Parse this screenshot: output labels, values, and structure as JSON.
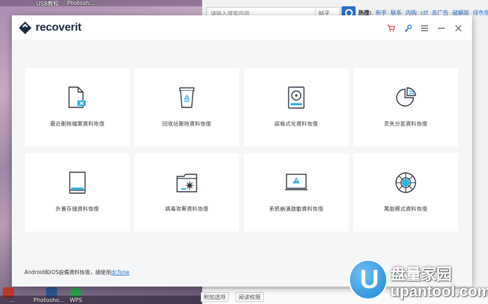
{
  "desktop": {
    "top_labels": [
      "USB教程",
      "Photosh..."
    ],
    "bottom_labels": [
      "...",
      "Photosho...",
      "WPS"
    ]
  },
  "browser": {
    "search_placeholder": "请输入搜索内容",
    "category": "帖子",
    "hot_label": "热搜:",
    "hot_items": [
      "新手",
      "联系",
      "内购",
      "ctf",
      "去广告",
      "破解版",
      "绿色版",
      "破"
    ],
    "bottom_buttons": [
      "附加选项",
      "阅读权限"
    ]
  },
  "app": {
    "name": "recoverit",
    "brand_color": "#1a2b3d",
    "accent_color": "#e8453c",
    "link_color": "#1a6fd0",
    "title_icons": [
      "cart-icon",
      "key-icon",
      "menu-icon",
      "minimize-icon",
      "close-icon"
    ],
    "cards": [
      {
        "label": "最近刪除檔案資料恢復",
        "icon": "deleted-file-icon"
      },
      {
        "label": "回收站刪除資料恢復",
        "icon": "recycle-bin-icon"
      },
      {
        "label": "誤格式化資料恢復",
        "icon": "formatted-drive-icon"
      },
      {
        "label": "丟失分區資料恢復",
        "icon": "lost-partition-icon"
      },
      {
        "label": "外置存儲資料恢復",
        "icon": "external-device-icon"
      },
      {
        "label": "病毒攻擊資料恢復",
        "icon": "virus-attack-icon"
      },
      {
        "label": "系統崩潰啟動資料恢復",
        "icon": "system-crash-icon"
      },
      {
        "label": "萬能模式資料恢復",
        "icon": "all-around-icon"
      }
    ],
    "footer_text": "Android和iOS設備資料恢復，請使用",
    "footer_link": "dr.fone"
  },
  "watermark": {
    "letter": "U",
    "cn": "盘量家园",
    "en": "upantool.com"
  }
}
